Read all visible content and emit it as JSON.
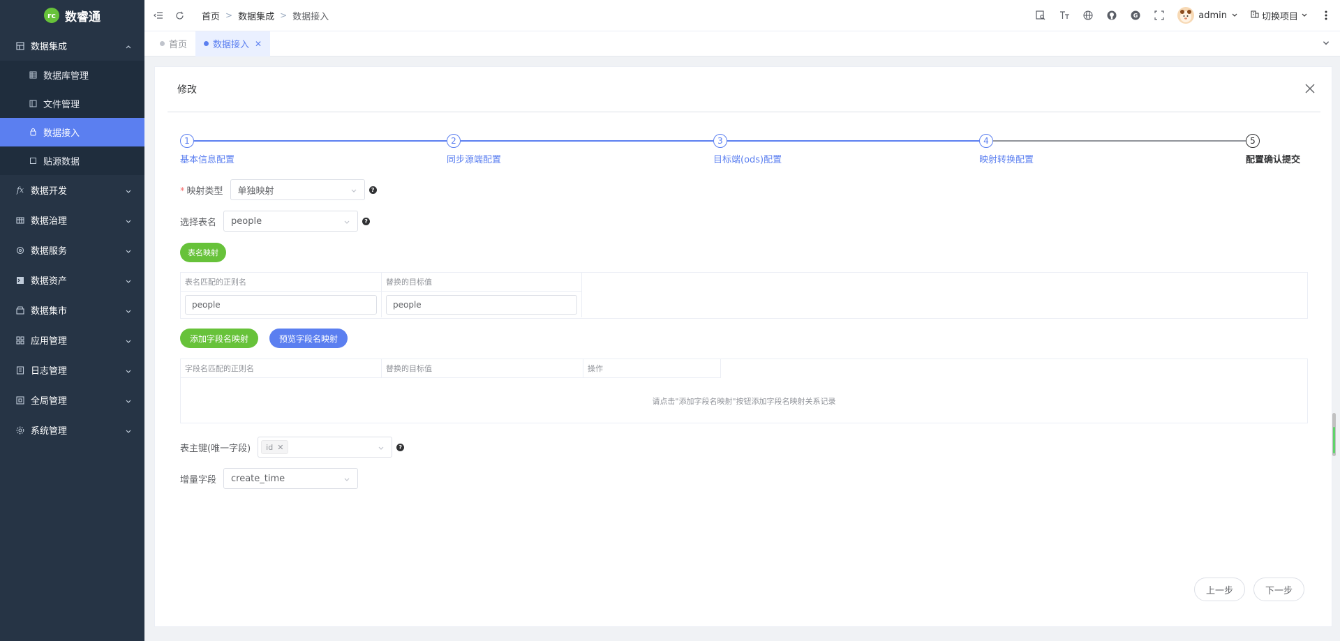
{
  "app": {
    "name": "数睿通",
    "logo_mark": "rc"
  },
  "sidebar": {
    "groups": [
      {
        "label": "数据集成",
        "icon": "grid-icon",
        "expanded": true,
        "children": [
          {
            "label": "数据库管理",
            "icon": "table-icon"
          },
          {
            "label": "文件管理",
            "icon": "file-icon"
          },
          {
            "label": "数据接入",
            "icon": "plug-icon",
            "active": true
          },
          {
            "label": "贴源数据",
            "icon": "square-icon"
          }
        ]
      },
      {
        "label": "数据开发",
        "icon": "fx-icon"
      },
      {
        "label": "数据治理",
        "icon": "table-icon"
      },
      {
        "label": "数据服务",
        "icon": "service-icon"
      },
      {
        "label": "数据资产",
        "icon": "asset-icon"
      },
      {
        "label": "数据集市",
        "icon": "market-icon"
      },
      {
        "label": "应用管理",
        "icon": "apps-icon"
      },
      {
        "label": "日志管理",
        "icon": "log-icon"
      },
      {
        "label": "全局管理",
        "icon": "global-icon"
      },
      {
        "label": "系统管理",
        "icon": "settings-icon"
      }
    ]
  },
  "navbar": {
    "breadcrumb": [
      "首页",
      "数据集成",
      "数据接入"
    ],
    "user": "admin",
    "project": "切换项目"
  },
  "tags": [
    {
      "label": "首页",
      "active": false
    },
    {
      "label": "数据接入",
      "active": true
    }
  ],
  "dialog": {
    "title": "修改",
    "steps": [
      {
        "num": "1",
        "title": "基本信息配置"
      },
      {
        "num": "2",
        "title": "同步源端配置"
      },
      {
        "num": "3",
        "title": "目标端(ods)配置"
      },
      {
        "num": "4",
        "title": "映射转换配置"
      },
      {
        "num": "5",
        "title": "配置确认提交"
      }
    ],
    "current_step": 5,
    "mapping_type": {
      "label": "映射类型",
      "value": "单独映射"
    },
    "table_name": {
      "label": "选择表名",
      "value": "people"
    },
    "table_mapping_button": "表名映射",
    "table_mapping": {
      "headers": [
        "表名匹配的正则名",
        "替换的目标值"
      ],
      "rows": [
        {
          "regex": "people",
          "target": "people"
        }
      ]
    },
    "add_field_button": "添加字段名映射",
    "preview_field_button": "预览字段名映射",
    "field_mapping": {
      "headers": [
        "字段名匹配的正则名",
        "替换的目标值",
        "操作"
      ],
      "empty_text": "请点击\"添加字段名映射\"按钮添加字段名映射关系记录"
    },
    "primary_key": {
      "label": "表主键(唯一字段)",
      "tags": [
        "id"
      ]
    },
    "incremental": {
      "label": "增量字段",
      "value": "create_time"
    },
    "prev_button": "上一步",
    "next_button": "下一步"
  },
  "colors": {
    "primary": "#5b7ff0",
    "success": "#67c23a",
    "sidebar_bg": "#263445"
  }
}
